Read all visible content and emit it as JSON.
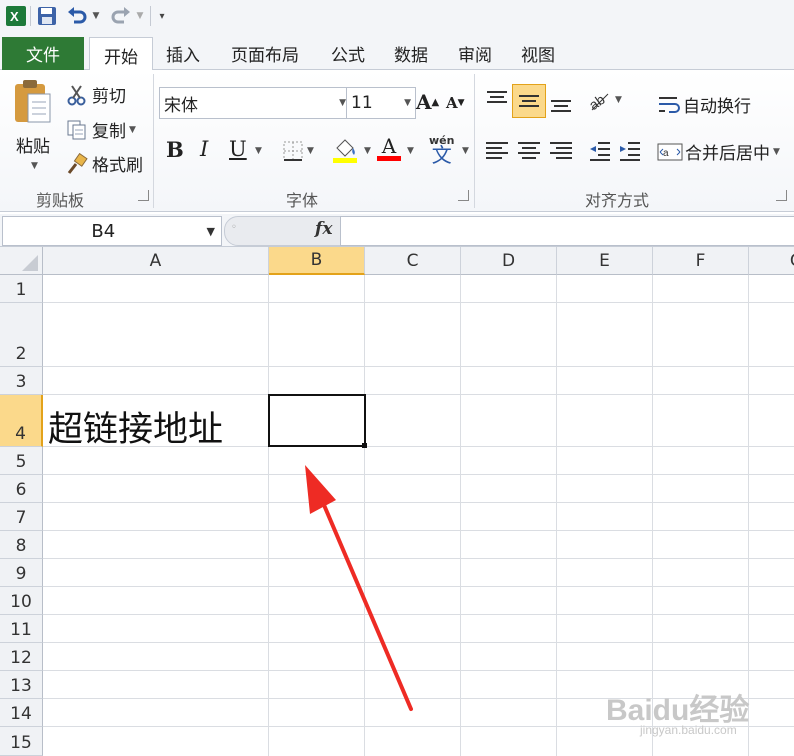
{
  "quick_access": {
    "app_icon": "excel-icon",
    "items": [
      "save-icon",
      "undo-icon",
      "redo-icon",
      "customize-icon"
    ]
  },
  "tabs": {
    "file": "文件",
    "items": [
      "开始",
      "插入",
      "页面布局",
      "公式",
      "数据",
      "审阅",
      "视图"
    ],
    "active": "开始"
  },
  "ribbon": {
    "clipboard": {
      "paste": "粘贴",
      "cut": "剪切",
      "copy": "复制",
      "format_painter": "格式刷",
      "group_label": "剪贴板"
    },
    "font": {
      "font_name": "宋体",
      "font_size": "11",
      "bold": "B",
      "italic": "I",
      "underline": "U",
      "group_label": "字体",
      "fill_color": "#ffff00",
      "font_color": "#ff0000"
    },
    "alignment": {
      "wrap_text": "自动换行",
      "merge_center": "合并后居中",
      "group_label": "对齐方式"
    }
  },
  "formula_bar": {
    "name_box": "B4",
    "fx_label": "fx",
    "formula": ""
  },
  "sheet": {
    "columns": [
      "A",
      "B",
      "C",
      "D",
      "E",
      "F",
      "G"
    ],
    "rows": [
      "1",
      "2",
      "3",
      "4",
      "5",
      "6",
      "7",
      "8",
      "9",
      "10",
      "11",
      "12",
      "13",
      "14",
      "15"
    ],
    "selected_column": "B",
    "selected_row": "4",
    "cells": {
      "A4": "超链接地址"
    }
  },
  "annotation": {
    "arrow_color": "#ee2b24"
  },
  "watermark": {
    "text": "Baidu经验",
    "sub": "jingyan.baidu.com"
  }
}
